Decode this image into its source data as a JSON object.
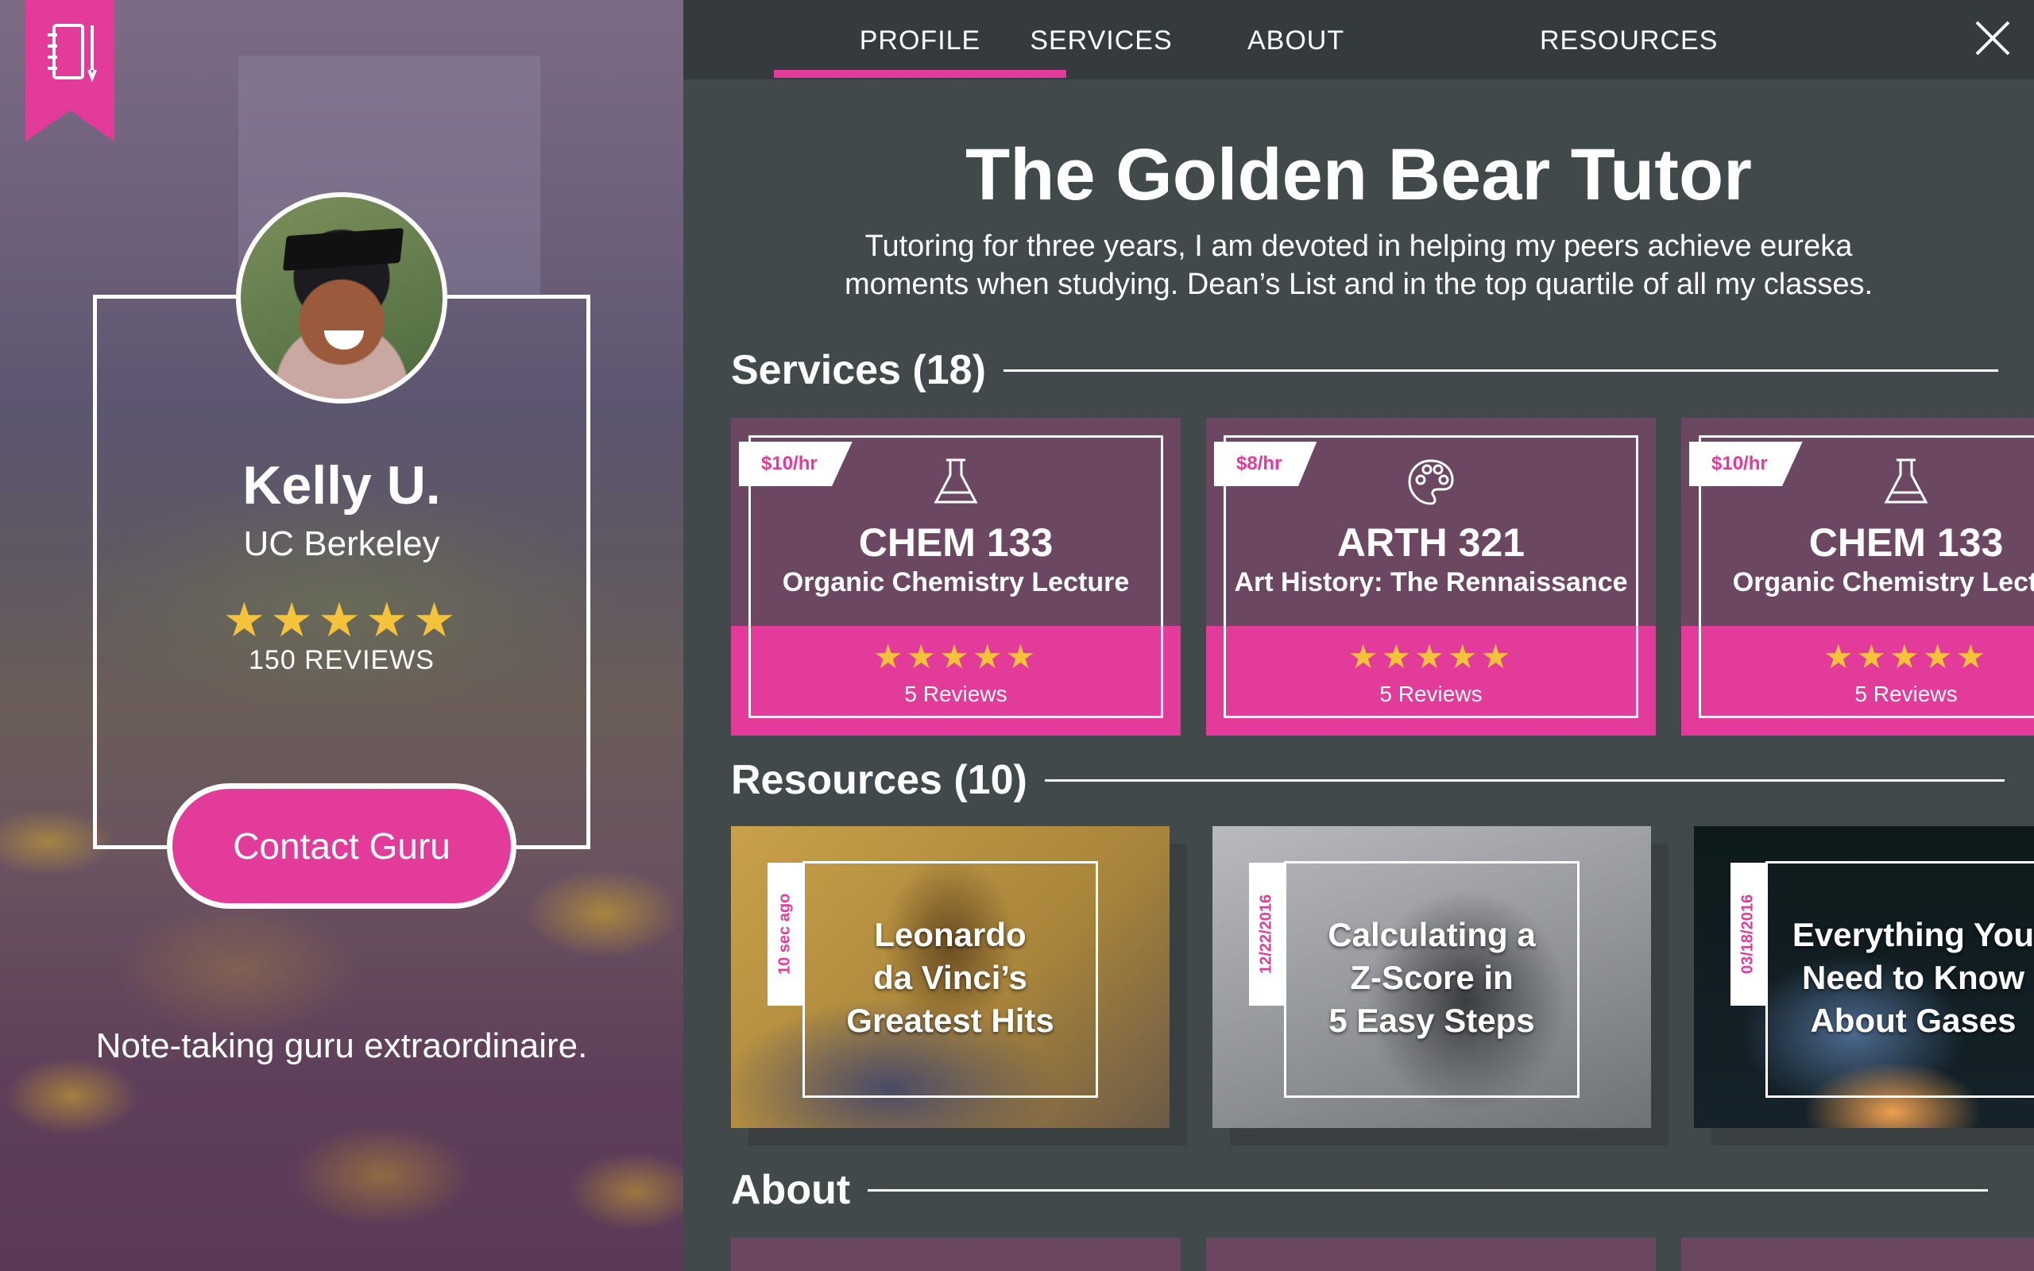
{
  "nav": {
    "tabs": [
      "PROFILE",
      "SERVICES",
      "ABOUT",
      "RESOURCES"
    ],
    "active_tab": "PROFILE"
  },
  "profile": {
    "name": "Kelly U.",
    "school": "UC Berkeley",
    "stars": "★★★★★",
    "rating": 5,
    "reviews": "150 REVIEWS",
    "contact_label": "Contact Guru",
    "tagline": "Note-taking guru extraordinaire."
  },
  "main": {
    "title": "The Golden Bear Tutor",
    "intro": "Tutoring for three years, I am devoted in helping my peers achieve eureka moments when studying. Dean’s List and in the top quartile of all my classes.",
    "services_heading": "Services (18)",
    "resources_heading": "Resources (10)",
    "about_heading": "About"
  },
  "services": [
    {
      "price": "$10/hr",
      "icon": "flask-icon",
      "code": "CHEM 133",
      "subject": "Organic Chemistry Lecture",
      "stars": "★★★★★",
      "rating": 5,
      "reviews": "5 Reviews"
    },
    {
      "price": "$8/hr",
      "icon": "palette-icon",
      "code": "ARTH 321",
      "subject": "Art History: The Rennaissance",
      "stars": "★★★★★",
      "rating": 5,
      "reviews": "5 Reviews"
    },
    {
      "price": "$10/hr",
      "icon": "flask-icon",
      "code": "CHEM 133",
      "subject": "Organic Chemistry Lecture",
      "stars": "★★★★★",
      "rating": 5,
      "reviews": "5 Reviews"
    }
  ],
  "resources": [
    {
      "date": "10 sec ago",
      "title_lines": [
        "Leonardo",
        "da Vinci’s",
        "Greatest Hits"
      ]
    },
    {
      "date": "12/22/2016",
      "title_lines": [
        "Calculating a",
        "Z-Score in",
        "5 Easy Steps"
      ]
    },
    {
      "date": "03/18/2016",
      "title_lines": [
        "Everything You",
        "Need to Know",
        "About Gases"
      ]
    }
  ],
  "colors": {
    "accent": "#e33b99",
    "panel": "#41494b",
    "nav": "#353b3d",
    "card": "#6b4761",
    "star": "#f5c23b"
  }
}
